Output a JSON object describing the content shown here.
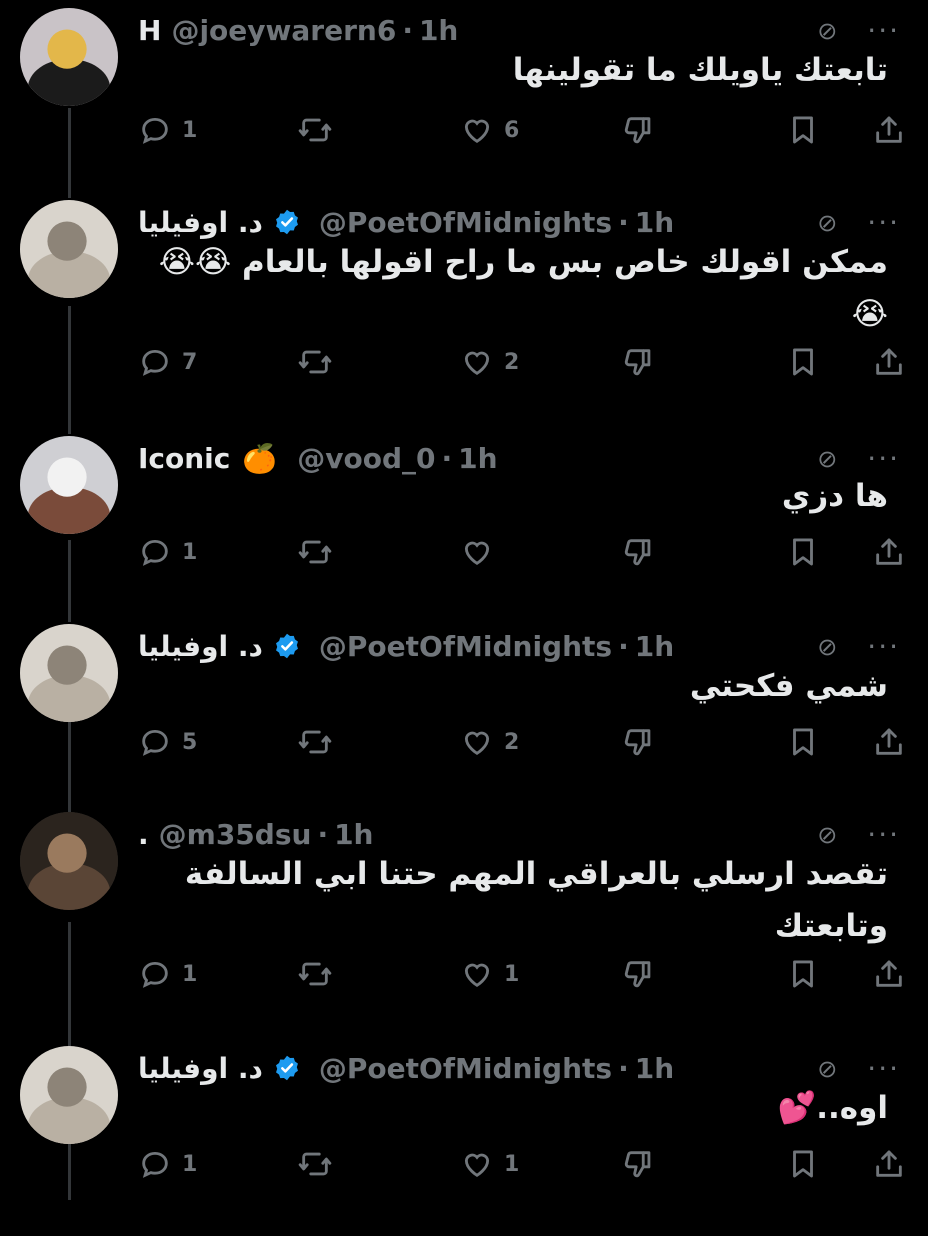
{
  "tweets": [
    {
      "name": "H",
      "verified": false,
      "name_emoji": "",
      "handle": "@joeywarern6",
      "separator": "·",
      "time": "1h",
      "text": "تابعتك ياويلك ما تقولينها",
      "replies": "1",
      "retweets": "",
      "likes": "6"
    },
    {
      "name": "د. اوفيليا",
      "verified": true,
      "name_emoji": "",
      "handle": "@PoetOfMidnights",
      "separator": "·",
      "time": "1h",
      "text": "ممكن اقولك خاص بس ما راح اقولها بالعام 😭😭😭",
      "replies": "7",
      "retweets": "",
      "likes": "2"
    },
    {
      "name": "Iconic",
      "verified": false,
      "name_emoji": "🍊",
      "handle": "@vood_0",
      "separator": "·",
      "time": "1h",
      "text": "ها دزي",
      "replies": "1",
      "retweets": "",
      "likes": ""
    },
    {
      "name": "د. اوفيليا",
      "verified": true,
      "name_emoji": "",
      "handle": "@PoetOfMidnights",
      "separator": "·",
      "time": "1h",
      "text": "شمي فكحتي",
      "replies": "5",
      "retweets": "",
      "likes": "2"
    },
    {
      "name": ".",
      "verified": false,
      "name_emoji": "",
      "handle": "@m35dsu",
      "separator": "·",
      "time": "1h",
      "text": "تقصد ارسلي بالعراقي المهم حتنا ابي السالفة وتابعتك",
      "replies": "1",
      "retweets": "",
      "likes": "1"
    },
    {
      "name": "د. اوفيليا",
      "verified": true,
      "name_emoji": "",
      "handle": "@PoetOfMidnights",
      "separator": "·",
      "time": "1h",
      "text": "اوه..💕",
      "replies": "1",
      "retweets": "",
      "likes": "1"
    }
  ],
  "icons": {
    "reply": "reply-icon",
    "retweet": "retweet-icon",
    "like": "heart-icon",
    "dislike": "dislike-icon",
    "bookmark": "bookmark-icon",
    "share": "share-icon",
    "grok": "slashed-circle-icon",
    "more": "more-icon",
    "verified": "verified-badge-icon"
  },
  "colors": {
    "background": "#000000",
    "text": "#e7e9ea",
    "muted": "#71767b",
    "verified": "#1d9bf0",
    "thread": "#333639"
  }
}
